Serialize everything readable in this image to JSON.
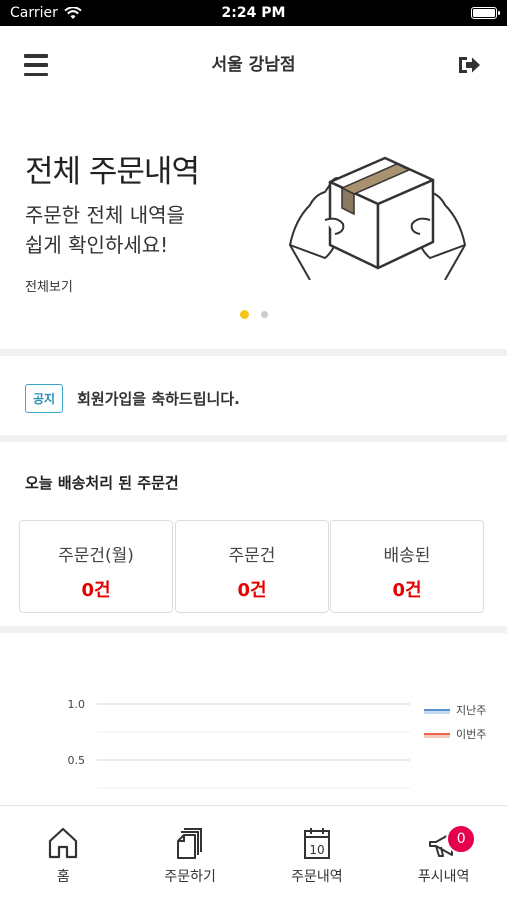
{
  "status_bar": {
    "carrier": "Carrier",
    "time": "2:24 PM"
  },
  "header": {
    "title": "서울 강남점"
  },
  "banner": {
    "title": "전체 주문내역",
    "subtitle": "주문한 전체 내역을\n쉽게 확인하세요!",
    "link": "전체보기",
    "page_count": 2,
    "active_page": 1
  },
  "notice": {
    "badge": "공지",
    "text": "회원가입을 축하드립니다."
  },
  "today": {
    "title": "오늘 배송처리 된 주문건",
    "stats": [
      {
        "label": "주문건(월)",
        "value": "0건"
      },
      {
        "label": "주문건",
        "value": "0건"
      },
      {
        "label": "배송된",
        "value": "0건"
      }
    ]
  },
  "chart_data": {
    "type": "line",
    "series": [
      {
        "name": "지난주",
        "color": "#5b8fd6",
        "values": []
      },
      {
        "name": "이번주",
        "color": "#e8674c",
        "values": []
      }
    ],
    "y_ticks": [
      "1.0",
      "0.5"
    ],
    "ylim": [
      0,
      1.0
    ],
    "legend": "right"
  },
  "tabbar": {
    "tabs": [
      {
        "label": "홈",
        "icon": "home-icon"
      },
      {
        "label": "주문하기",
        "icon": "documents-icon"
      },
      {
        "label": "주문내역",
        "icon": "calendar-icon",
        "icon_text": "10"
      },
      {
        "label": "푸시내역",
        "icon": "megaphone-icon",
        "badge": "0"
      }
    ]
  },
  "colors": {
    "accent_red": "#e60000",
    "notice_blue": "#2b8fb3",
    "dot_active": "#f5c518",
    "badge_pink": "#e6004c"
  }
}
